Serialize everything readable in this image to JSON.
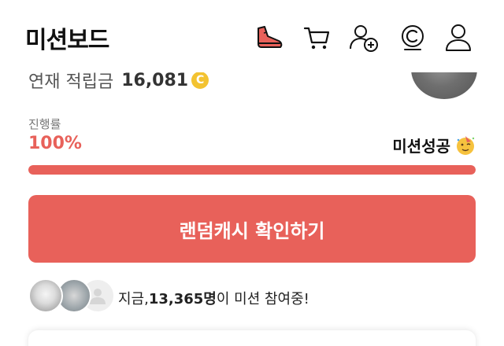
{
  "header": {
    "title": "미션보드",
    "icons": [
      "shoe-icon",
      "cart-icon",
      "add-friend-icon",
      "coin-icon",
      "profile-icon"
    ]
  },
  "reward": {
    "label": "연재 적립금",
    "value": "16,081",
    "coin_symbol": "C"
  },
  "progress": {
    "label": "진행률",
    "percent_text": "100%",
    "fraction": 1.0,
    "status": "미션성공"
  },
  "cta": {
    "label": "랜덤캐시 확인하기"
  },
  "participants": {
    "prefix": "지금, ",
    "count": "13,365명",
    "suffix": "이 미션 참여중!"
  },
  "colors": {
    "accent": "#e8615a",
    "track": "#f1d8d6",
    "coin": "#f3c331"
  }
}
